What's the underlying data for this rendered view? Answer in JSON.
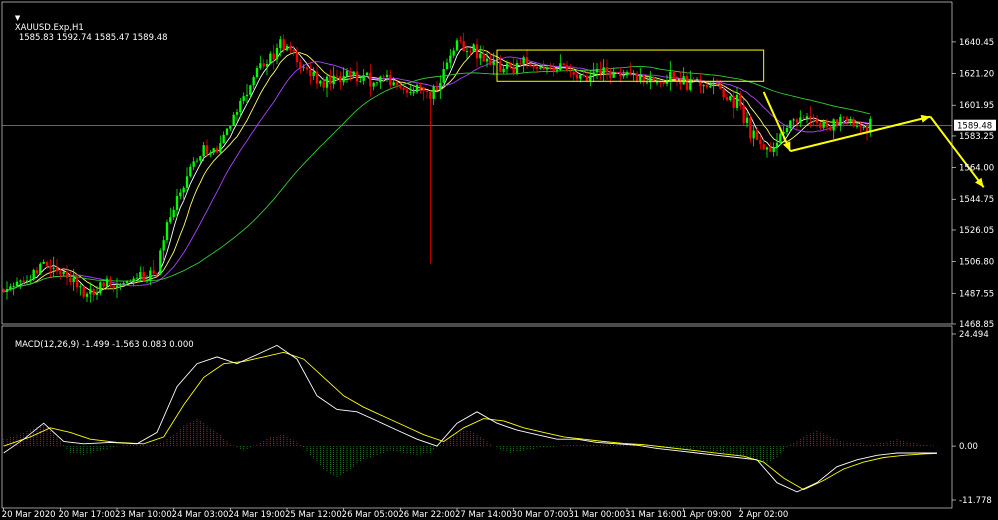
{
  "header": {
    "symbol_label": "XAUUSD.Exp,H1",
    "ohlc": "1585.83 1592.74 1585.47 1589.48"
  },
  "macd": {
    "label": "MACD(12,26,9) -1.499 -1.563 0.083 0.000"
  },
  "colors": {
    "background": "#000000",
    "grid": "#ffffff",
    "bull": "#00ff00",
    "bear": "#ff0000",
    "ma_fast": "#ffffff",
    "ma_mid": "#ffff66",
    "ma_slow": "#aa44ff",
    "ma_long": "#33cc33",
    "annotation": "#ffff00",
    "macd_line": "#ffffff",
    "signal_line": "#ffff00",
    "hist_pos": "#ff2222",
    "hist_neg": "#22aa22",
    "current_price_line": "#a0a0a0"
  },
  "chart_data": [
    {
      "type": "candlestick",
      "title": "XAUUSD.Exp,H1",
      "ylim": [
        1468.85,
        1655.0
      ],
      "yticks": [
        "1640.45",
        "1621.20",
        "1601.95",
        "1583.25",
        "1564.00",
        "1544.75",
        "1526.05",
        "1506.80",
        "1487.55",
        "1468.85"
      ],
      "current_price": "1589.48",
      "close_path": [
        [
          0,
          1490
        ],
        [
          6,
          1495
        ],
        [
          12,
          1508
        ],
        [
          18,
          1498
        ],
        [
          24,
          1486
        ],
        [
          30,
          1495
        ],
        [
          34,
          1493
        ],
        [
          40,
          1496
        ],
        [
          46,
          1498
        ],
        [
          48,
          1525
        ],
        [
          52,
          1545
        ],
        [
          56,
          1560
        ],
        [
          60,
          1575
        ],
        [
          64,
          1573
        ],
        [
          68,
          1590
        ],
        [
          72,
          1605
        ],
        [
          76,
          1625
        ],
        [
          80,
          1632
        ],
        [
          84,
          1638
        ],
        [
          88,
          1630
        ],
        [
          92,
          1620
        ],
        [
          96,
          1615
        ],
        [
          100,
          1616
        ],
        [
          104,
          1622
        ],
        [
          108,
          1620
        ],
        [
          112,
          1616
        ],
        [
          116,
          1617
        ],
        [
          120,
          1612
        ],
        [
          124,
          1610
        ],
        [
          128,
          1607
        ],
        [
          132,
          1620
        ],
        [
          136,
          1640
        ],
        [
          140,
          1638
        ],
        [
          144,
          1632
        ],
        [
          148,
          1625
        ],
        [
          152,
          1625
        ],
        [
          156,
          1628
        ],
        [
          160,
          1622
        ],
        [
          164,
          1624
        ],
        [
          168,
          1626
        ],
        [
          172,
          1618
        ],
        [
          176,
          1620
        ],
        [
          180,
          1624
        ],
        [
          184,
          1620
        ],
        [
          188,
          1622
        ],
        [
          192,
          1616
        ],
        [
          196,
          1618
        ],
        [
          200,
          1617
        ],
        [
          204,
          1615
        ],
        [
          208,
          1616
        ],
        [
          212,
          1614
        ],
        [
          216,
          1608
        ],
        [
          220,
          1605
        ],
        [
          224,
          1585
        ],
        [
          228,
          1576
        ],
        [
          232,
          1580
        ],
        [
          236,
          1590
        ],
        [
          240,
          1596
        ],
        [
          244,
          1590
        ],
        [
          248,
          1588
        ],
        [
          252,
          1594
        ],
        [
          256,
          1592
        ],
        [
          260,
          1589
        ]
      ],
      "spike": {
        "bar": 128,
        "low": 1505.5
      },
      "x_tick_labels": [
        "20 Mar 2020",
        "20 Mar 17:00",
        "23 Mar 10:00",
        "24 Mar 03:00",
        "24 Mar 19:00",
        "25 Mar 12:00",
        "26 Mar 05:00",
        "26 Mar 22:00",
        "27 Mar 14:00",
        "30 Mar 07:00",
        "31 Mar 00:00",
        "31 Mar 16:00",
        "1 Apr 09:00",
        "2 Apr 02:00"
      ],
      "x_tick_bars": [
        0,
        17,
        34,
        51,
        68,
        85,
        102,
        119,
        136,
        153,
        170,
        187,
        204,
        221
      ],
      "annotations": {
        "consolidation_box": {
          "bars": [
            148,
            228
          ],
          "range": [
            1616.5,
            1635.5
          ]
        },
        "arrows": [
          {
            "from": [
              228,
              1610
            ],
            "to": [
              236,
              1574
            ]
          },
          {
            "from": [
              236,
              1574
            ],
            "to": [
              278,
              1595
            ]
          },
          {
            "from": [
              278,
              1595
            ],
            "to": [
              294,
              1552
            ]
          }
        ]
      }
    },
    {
      "type": "macd",
      "title": "MACD(12,26,9)",
      "ylim": [
        -11.778,
        24.494
      ],
      "yticks": [
        "24.494",
        "0.00",
        "-11.778"
      ],
      "macd_line_points": [
        [
          0,
          -1.5
        ],
        [
          6,
          1.5
        ],
        [
          12,
          5
        ],
        [
          18,
          1
        ],
        [
          24,
          0.5
        ],
        [
          32,
          0.8
        ],
        [
          40,
          0.5
        ],
        [
          46,
          3
        ],
        [
          52,
          13
        ],
        [
          58,
          18
        ],
        [
          64,
          19.5
        ],
        [
          70,
          18
        ],
        [
          76,
          20
        ],
        [
          82,
          22
        ],
        [
          88,
          19
        ],
        [
          94,
          11
        ],
        [
          100,
          8
        ],
        [
          106,
          7.5
        ],
        [
          112,
          5.5
        ],
        [
          118,
          3.5
        ],
        [
          124,
          1.5
        ],
        [
          130,
          0
        ],
        [
          136,
          5
        ],
        [
          142,
          7.5
        ],
        [
          148,
          5
        ],
        [
          154,
          3.5
        ],
        [
          160,
          2.5
        ],
        [
          166,
          1.5
        ],
        [
          172,
          1.5
        ],
        [
          178,
          0.8
        ],
        [
          184,
          0.5
        ],
        [
          190,
          0.2
        ],
        [
          196,
          -0.5
        ],
        [
          202,
          -1
        ],
        [
          208,
          -1.5
        ],
        [
          214,
          -2
        ],
        [
          220,
          -2.5
        ],
        [
          226,
          -3
        ],
        [
          232,
          -8
        ],
        [
          238,
          -10
        ],
        [
          244,
          -8
        ],
        [
          250,
          -4.5
        ],
        [
          256,
          -3
        ],
        [
          262,
          -2
        ],
        [
          268,
          -1.5
        ],
        [
          274,
          -1.5
        ],
        [
          280,
          -1.5
        ]
      ],
      "signal_line_points": [
        [
          0,
          0
        ],
        [
          8,
          2
        ],
        [
          14,
          4
        ],
        [
          20,
          3
        ],
        [
          26,
          1.5
        ],
        [
          34,
          0.8
        ],
        [
          42,
          0.5
        ],
        [
          48,
          2
        ],
        [
          54,
          9
        ],
        [
          60,
          15
        ],
        [
          66,
          18
        ],
        [
          72,
          18.5
        ],
        [
          78,
          19.5
        ],
        [
          84,
          20.5
        ],
        [
          90,
          19
        ],
        [
          96,
          15
        ],
        [
          102,
          11
        ],
        [
          108,
          8.5
        ],
        [
          114,
          6.5
        ],
        [
          120,
          4.5
        ],
        [
          126,
          2.5
        ],
        [
          132,
          1
        ],
        [
          138,
          4
        ],
        [
          144,
          6
        ],
        [
          150,
          5.5
        ],
        [
          156,
          4
        ],
        [
          162,
          3
        ],
        [
          168,
          2
        ],
        [
          174,
          1.5
        ],
        [
          180,
          1
        ],
        [
          186,
          0.6
        ],
        [
          192,
          0.3
        ],
        [
          198,
          -0.2
        ],
        [
          204,
          -0.7
        ],
        [
          210,
          -1.2
        ],
        [
          216,
          -1.7
        ],
        [
          222,
          -2.2
        ],
        [
          228,
          -3.5
        ],
        [
          234,
          -7
        ],
        [
          240,
          -9.5
        ],
        [
          246,
          -7.5
        ],
        [
          252,
          -5
        ],
        [
          258,
          -3.5
        ],
        [
          264,
          -2.5
        ],
        [
          270,
          -2
        ],
        [
          276,
          -1.7
        ],
        [
          280,
          -1.6
        ]
      ],
      "histogram": [
        [
          0,
          1.5
        ],
        [
          6,
          3
        ],
        [
          12,
          5
        ],
        [
          16,
          2
        ],
        [
          20,
          -1.5
        ],
        [
          24,
          -2
        ],
        [
          28,
          -1.2
        ],
        [
          32,
          -0.5
        ],
        [
          36,
          0.2
        ],
        [
          40,
          0.5
        ],
        [
          44,
          0.4
        ],
        [
          48,
          1
        ],
        [
          52,
          3
        ],
        [
          54,
          4.5
        ],
        [
          58,
          6
        ],
        [
          60,
          5
        ],
        [
          64,
          3
        ],
        [
          68,
          0.5
        ],
        [
          72,
          -1
        ],
        [
          76,
          0.5
        ],
        [
          80,
          2
        ],
        [
          84,
          2.5
        ],
        [
          88,
          1
        ],
        [
          92,
          -2
        ],
        [
          96,
          -5
        ],
        [
          100,
          -7
        ],
        [
          104,
          -5
        ],
        [
          108,
          -3
        ],
        [
          112,
          -2
        ],
        [
          116,
          -1
        ],
        [
          120,
          -1.5
        ],
        [
          124,
          -2
        ],
        [
          128,
          -1.5
        ],
        [
          132,
          1
        ],
        [
          136,
          3
        ],
        [
          140,
          3.5
        ],
        [
          144,
          1.5
        ],
        [
          148,
          -0.5
        ],
        [
          152,
          -1.5
        ],
        [
          156,
          -1
        ],
        [
          160,
          -0.5
        ],
        [
          164,
          -0.3
        ],
        [
          168,
          0.2
        ],
        [
          172,
          0.4
        ],
        [
          176,
          0.3
        ],
        [
          180,
          0.4
        ],
        [
          184,
          0.3
        ],
        [
          188,
          0.2
        ],
        [
          192,
          0.2
        ],
        [
          196,
          -0.2
        ],
        [
          200,
          -0.5
        ],
        [
          204,
          -0.8
        ],
        [
          208,
          -0.5
        ],
        [
          212,
          -1
        ],
        [
          216,
          -1.5
        ],
        [
          220,
          -2
        ],
        [
          224,
          -2.5
        ],
        [
          228,
          -4
        ],
        [
          232,
          -2.5
        ],
        [
          236,
          0.5
        ],
        [
          240,
          2
        ],
        [
          244,
          3.5
        ],
        [
          248,
          2
        ],
        [
          252,
          1
        ],
        [
          256,
          0.8
        ],
        [
          260,
          0.3
        ],
        [
          264,
          0.8
        ],
        [
          268,
          1.5
        ],
        [
          272,
          0.8
        ],
        [
          276,
          0.3
        ],
        [
          280,
          0
        ]
      ]
    }
  ]
}
